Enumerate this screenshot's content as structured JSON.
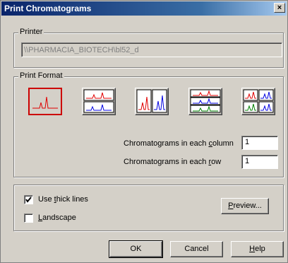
{
  "window": {
    "title": "Print Chromatograms",
    "close_glyph": "×"
  },
  "printer": {
    "label": "Printer",
    "value": "\\\\PHARMACIA_BIOTECH\\bl52_d"
  },
  "print_format": {
    "label": "Print Format",
    "options": [
      {
        "name": "single",
        "selected": true
      },
      {
        "name": "two-rows",
        "selected": false
      },
      {
        "name": "two-columns",
        "selected": false
      },
      {
        "name": "three-rows",
        "selected": false
      },
      {
        "name": "grid-2x2",
        "selected": false
      }
    ],
    "columns_label": {
      "pre": "Chromatograms in each ",
      "key": "c",
      "post": "olumn"
    },
    "columns_value": "1",
    "rows_label": {
      "pre": "Chromatograms in each ",
      "key": "r",
      "post": "ow"
    },
    "rows_value": "1"
  },
  "options": {
    "thick_lines": {
      "pre": "Use ",
      "key": "t",
      "post": "hick lines",
      "checked": true
    },
    "landscape": {
      "pre": "",
      "key": "L",
      "post": "andscape",
      "checked": false
    }
  },
  "buttons": {
    "preview": {
      "pre": "",
      "key": "P",
      "post": "review..."
    },
    "ok": "OK",
    "cancel": "Cancel",
    "help": {
      "pre": "",
      "key": "H",
      "post": "elp"
    }
  },
  "colors": {
    "red": "#e00000",
    "blue": "#0000e0",
    "green": "#008000",
    "selected_border": "#cc0000"
  }
}
